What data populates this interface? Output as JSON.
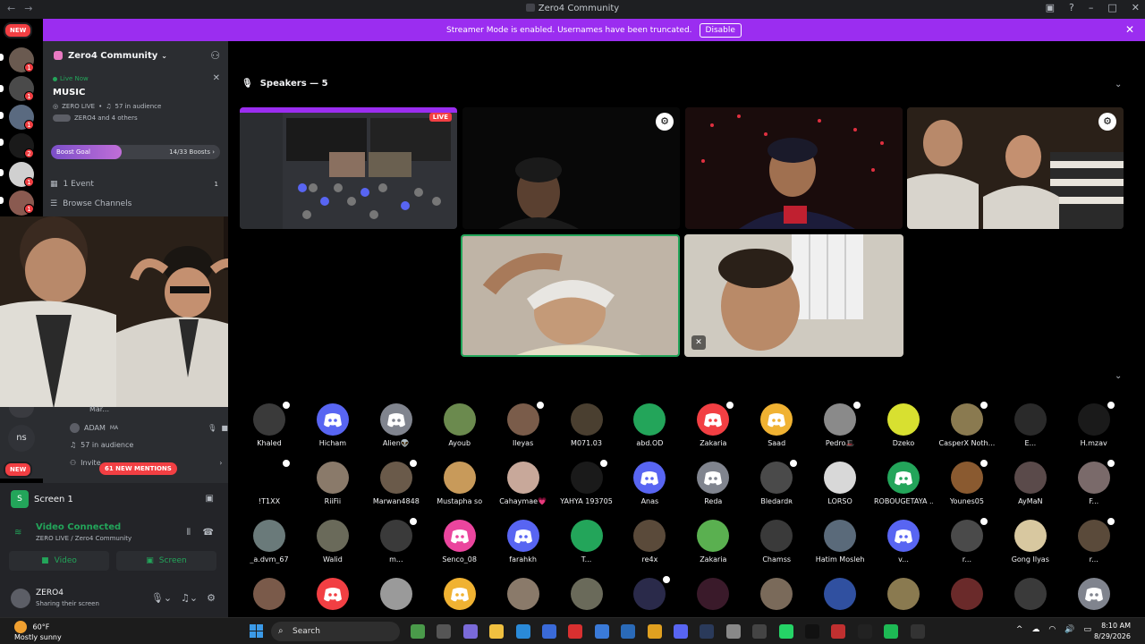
{
  "window": {
    "title": "Zero4 Community"
  },
  "banner": {
    "text": "Streamer Mode is enabled. Usernames have been truncated.",
    "button": "Disable"
  },
  "guilds": {
    "new_label": "NEW",
    "new_label_bottom": "NEW",
    "ns_label": "ns"
  },
  "server": {
    "name": "Zero4 Community"
  },
  "live": {
    "status": "Live Now",
    "title": "MUSIC",
    "host": "ZERO LIVE",
    "audience": "57 in audience",
    "participants": "ZERO4 and 4 others"
  },
  "boost": {
    "label": "Boost Goal",
    "count": "14/33 Boosts",
    "progress": 0.42
  },
  "side_rows": {
    "events": "1 Event",
    "events_count": "1",
    "browse": "Browse Channels"
  },
  "lower_side": {
    "user1": "Mar...",
    "user2": "ADAM",
    "user2_tag": "MA",
    "audience": "57 in audience",
    "invite": "Invite...",
    "mentions": "61 NEW MENTIONS"
  },
  "panel": {
    "screen_label": "Screen 1",
    "voice_status": "Video Connected",
    "voice_channel": "ZERO LIVE / Zero4 Community",
    "video_button": "Video",
    "screen_button": "Screen"
  },
  "user": {
    "name": "ZERO4",
    "status": "Sharing their screen"
  },
  "stage": {
    "speakers_header": "Speakers — 5",
    "live_tag": "LIVE"
  },
  "audience": [
    {
      "name": "Khaled",
      "color": "#3a3a3a",
      "gear": true
    },
    {
      "name": "Hicham",
      "color": "#5865f2",
      "gear": false,
      "discord": true
    },
    {
      "name": "Alien👽",
      "color": "#80848e",
      "gear": false,
      "discord": true
    },
    {
      "name": "Ayoub",
      "color": "#6b8a4e",
      "gear": false
    },
    {
      "name": "Ileyas",
      "color": "#7a5c4a",
      "gear": true
    },
    {
      "name": "M071.03",
      "color": "#4a3f30",
      "gear": false
    },
    {
      "name": "abd.OD",
      "color": "#23a55a",
      "gear": false
    },
    {
      "name": "Zakaria",
      "color": "#f23f43",
      "gear": true,
      "discord": true
    },
    {
      "name": "Saad",
      "color": "#f0b232",
      "gear": false,
      "discord": true
    },
    {
      "name": "Pedro🎩",
      "color": "#8a8a8a",
      "gear": true
    },
    {
      "name": "Dzeko",
      "color": "#d8e030",
      "gear": false
    },
    {
      "name": "CasperX Noth...",
      "color": "#8a7a50",
      "gear": true
    },
    {
      "name": "E...",
      "color": "#2a2a2a",
      "gear": false
    },
    {
      "name": "H.mzav",
      "color": "#1a1a1a",
      "gear": true
    },
    {
      "name": "!T1XX",
      "color": "#000000",
      "gear": true
    },
    {
      "name": "RiiFii",
      "color": "#8a7a6a",
      "gear": false
    },
    {
      "name": "Marwan4848",
      "color": "#6a5a4a",
      "gear": true
    },
    {
      "name": "Mustapha so",
      "color": "#c89a5a",
      "gear": false
    },
    {
      "name": "Cahaymae💗",
      "color": "#c8a89a",
      "gear": false
    },
    {
      "name": "YAHYA 193705",
      "color": "#1a1a1a",
      "gear": true
    },
    {
      "name": "Anas",
      "color": "#5865f2",
      "gear": false,
      "discord": true
    },
    {
      "name": "Reda",
      "color": "#80848e",
      "gear": false,
      "discord": true
    },
    {
      "name": "Bledardʀ",
      "color": "#4a4a4a",
      "gear": true
    },
    {
      "name": "LORSO",
      "color": "#d8d8d8",
      "gear": false
    },
    {
      "name": "ROBOUGETAYA ...",
      "color": "#23a55a",
      "gear": false,
      "discord": true
    },
    {
      "name": "Younes05",
      "color": "#8a5a30",
      "gear": true
    },
    {
      "name": "AyMaN",
      "color": "#5a4a4a",
      "gear": false
    },
    {
      "name": "F...",
      "color": "#7a6a6a",
      "gear": true
    },
    {
      "name": "_a.dvm_67",
      "color": "#6a7a7a",
      "gear": false
    },
    {
      "name": "Walid",
      "color": "#6a6a5a",
      "gear": false
    },
    {
      "name": "m...",
      "color": "#3a3a3a",
      "gear": true
    },
    {
      "name": "Senco_08",
      "color": "#eb459e",
      "gear": false,
      "discord": true
    },
    {
      "name": "farahkh",
      "color": "#5865f2",
      "gear": false,
      "discord": true
    },
    {
      "name": "T...",
      "color": "#23a55a",
      "gear": false
    },
    {
      "name": "re4x",
      "color": "#5a4a3a",
      "gear": false
    },
    {
      "name": "Zakaria",
      "color": "#5ab050",
      "gear": false
    },
    {
      "name": "Chamss",
      "color": "#3a3a3a",
      "gear": false
    },
    {
      "name": "Hatim Mosleh",
      "color": "#5a6a7a",
      "gear": false
    },
    {
      "name": "v...",
      "color": "#5865f2",
      "gear": false,
      "discord": true
    },
    {
      "name": "r...",
      "color": "#4a4a4a",
      "gear": true
    },
    {
      "name": "Gong Ilyas",
      "color": "#d8c8a0",
      "gear": false
    },
    {
      "name": "r...",
      "color": "#5a4a3a",
      "gear": true
    },
    {
      "name": "",
      "color": "#7a5a4a",
      "gear": false
    },
    {
      "name": "",
      "color": "#f23f43",
      "gear": false,
      "discord": true
    },
    {
      "name": "",
      "color": "#9a9a9a",
      "gear": false
    },
    {
      "name": "",
      "color": "#f0b232",
      "gear": false,
      "discord": true
    },
    {
      "name": "",
      "color": "#8a7a6a",
      "gear": false
    },
    {
      "name": "",
      "color": "#6a6a5a",
      "gear": false
    },
    {
      "name": "",
      "color": "#2a2a4a",
      "gear": true
    },
    {
      "name": "",
      "color": "#3a1a2a",
      "gear": false
    },
    {
      "name": "",
      "color": "#7a6a5a",
      "gear": false
    },
    {
      "name": "",
      "color": "#3050a0",
      "gear": false
    },
    {
      "name": "",
      "color": "#8a7a50",
      "gear": false
    },
    {
      "name": "",
      "color": "#6a2a2a",
      "gear": false
    },
    {
      "name": "",
      "color": "#3a3a3a",
      "gear": false
    },
    {
      "name": "",
      "color": "#80848e",
      "gear": false,
      "discord": true
    }
  ],
  "taskbar": {
    "temp": "60°F",
    "weather": "Mostly sunny",
    "search": "Search",
    "time": "8:10 AM",
    "date": "8/29/2026"
  }
}
